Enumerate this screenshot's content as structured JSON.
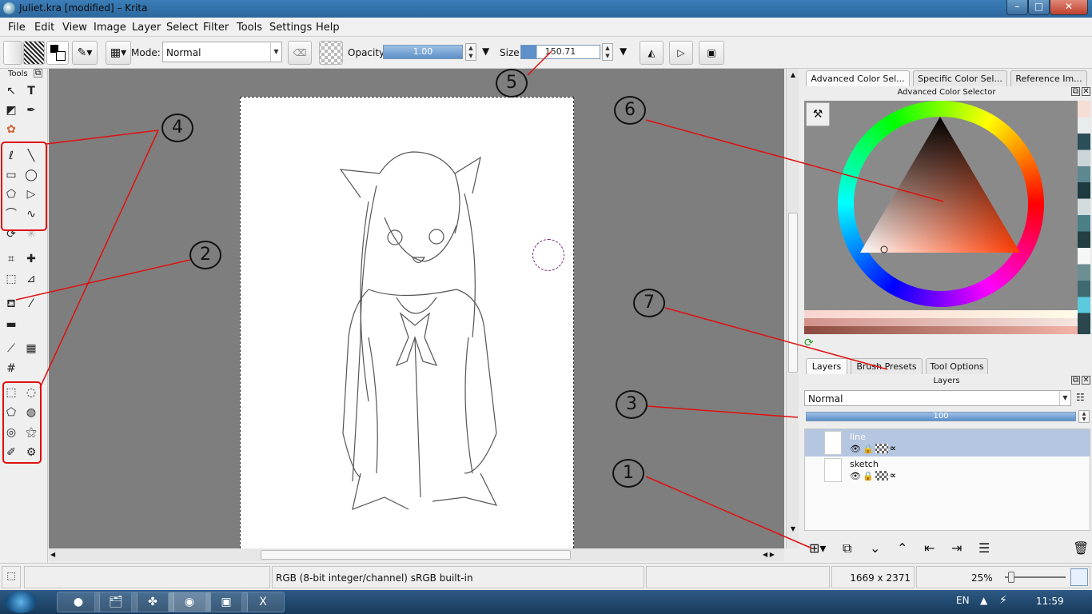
{
  "window": {
    "title": "Juliet.kra [modified] – Krita",
    "min": "–",
    "max": "□",
    "close": "✕"
  },
  "menu": [
    "File",
    "Edit",
    "View",
    "Image",
    "Layer",
    "Select",
    "Filter",
    "Tools",
    "Settings",
    "Help"
  ],
  "toolbar": {
    "mode_label": "Mode:",
    "mode_value": "Normal",
    "opacity_label": "Opacity:",
    "opacity_value": "1.00",
    "size_label": "Size:",
    "size_value": "150.71"
  },
  "toolbox": {
    "title": "Tools"
  },
  "docker_top": {
    "tabs": [
      "Advanced Color Sel...",
      "Specific Color Sel...",
      "Reference Im..."
    ],
    "panel_title": "Advanced Color Selector"
  },
  "docker_bottom": {
    "tabs": [
      "Layers",
      "Brush Presets",
      "Tool Options"
    ],
    "panel_title": "Layers",
    "blend_mode": "Normal",
    "opacity": "100",
    "layers": [
      {
        "name": "line",
        "selected": true
      },
      {
        "name": "sketch",
        "selected": false
      }
    ]
  },
  "status": {
    "color_profile": "RGB (8-bit integer/channel)  sRGB built-in",
    "dimensions": "1669 x 2371",
    "zoom": "25%"
  },
  "taskbar": {
    "lang": "EN",
    "clock": "11:59"
  },
  "annotations": [
    "1",
    "2",
    "3",
    "4",
    "5",
    "6",
    "7"
  ],
  "colors": {
    "annotation_line": "#e01010",
    "slider_fill": "#5d8fc8",
    "canvas_bg": "#7e7e7e",
    "title_bar": "#2b679d"
  }
}
